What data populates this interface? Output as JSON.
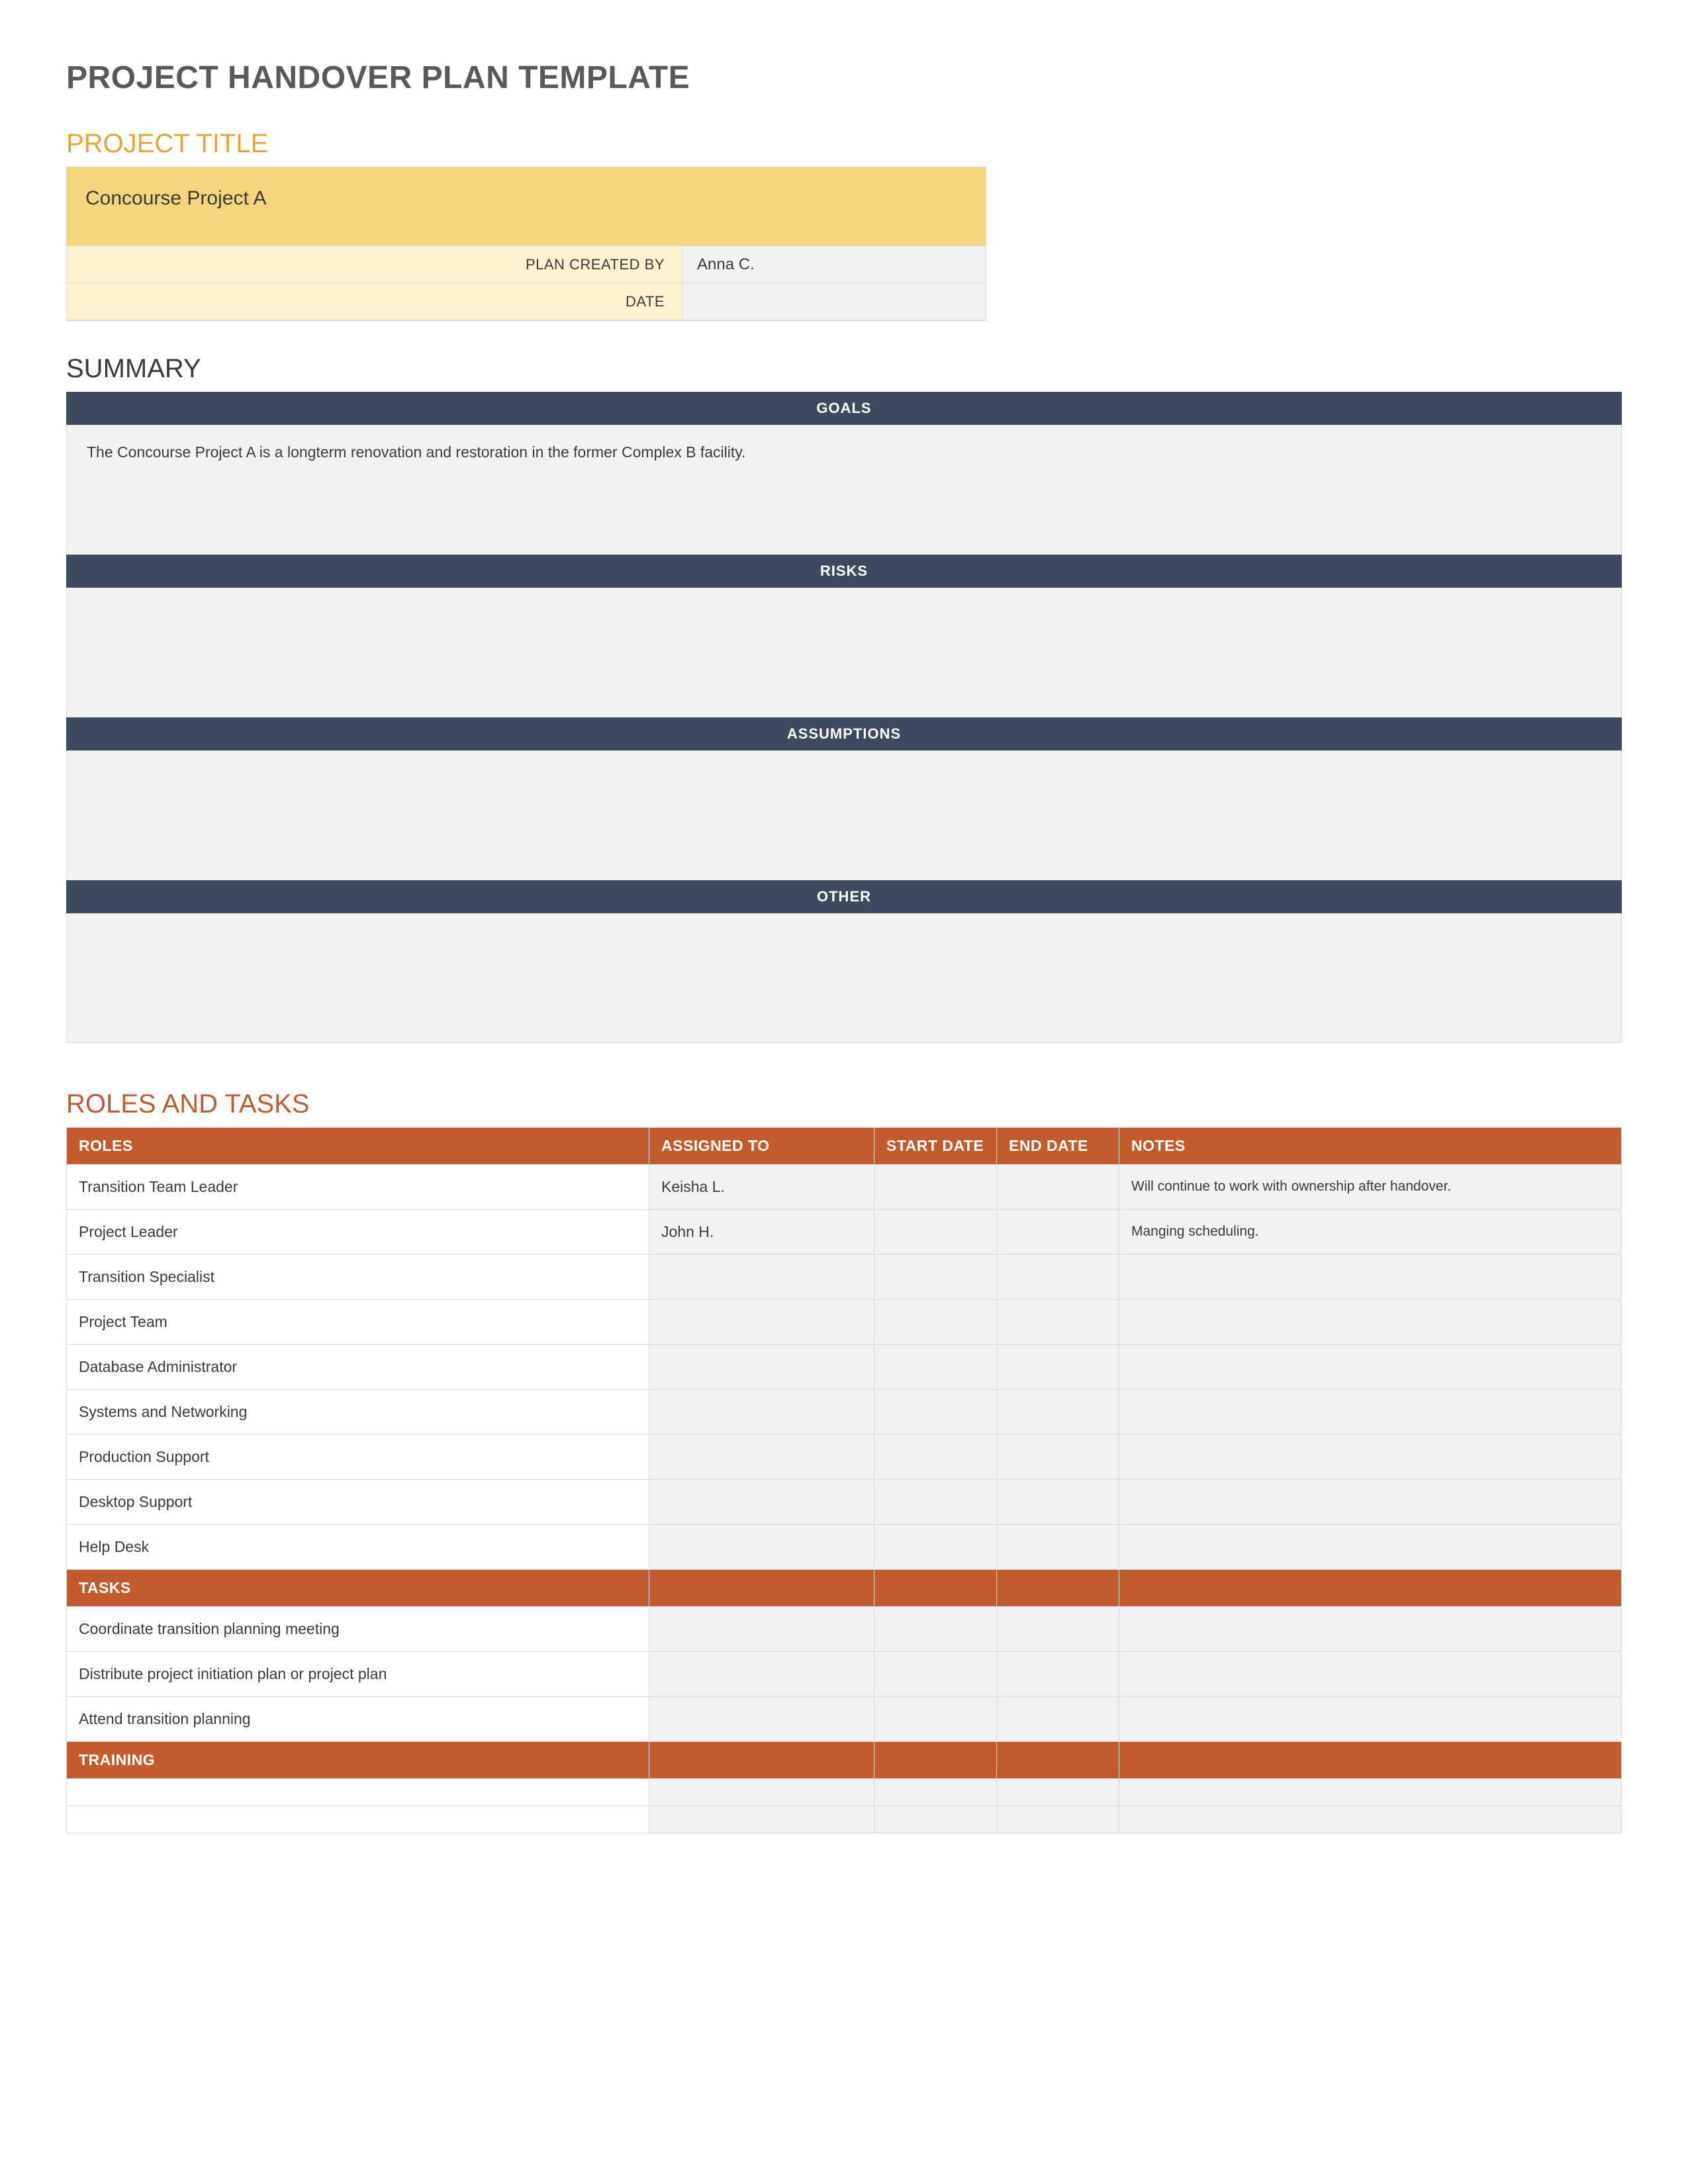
{
  "doc_title": "PROJECT HANDOVER PLAN TEMPLATE",
  "project_title": {
    "heading": "PROJECT TITLE",
    "name": "Concourse Project A",
    "plan_created_by_label": "PLAN CREATED BY",
    "plan_created_by_value": "Anna C.",
    "date_label": "DATE",
    "date_value": ""
  },
  "summary": {
    "heading": "SUMMARY",
    "sections": [
      {
        "title": "GOALS",
        "body": "The Concourse Project A is a longterm renovation and restoration in the former Complex B facility."
      },
      {
        "title": "RISKS",
        "body": ""
      },
      {
        "title": "ASSUMPTIONS",
        "body": ""
      },
      {
        "title": "OTHER",
        "body": ""
      }
    ]
  },
  "roles_tasks": {
    "heading": "ROLES AND TASKS",
    "columns": {
      "roles": "ROLES",
      "assigned_to": "ASSIGNED TO",
      "start_date": "START DATE",
      "end_date": "END DATE",
      "notes": "NOTES"
    },
    "roles_rows": [
      {
        "role": "Transition Team Leader",
        "assigned": "Keisha L.",
        "start": "",
        "end": "",
        "notes": "Will continue to work with ownership after handover."
      },
      {
        "role": "Project Leader",
        "assigned": "John H.",
        "start": "",
        "end": "",
        "notes": "Manging scheduling."
      },
      {
        "role": "Transition Specialist",
        "assigned": "",
        "start": "",
        "end": "",
        "notes": ""
      },
      {
        "role": "Project Team",
        "assigned": "",
        "start": "",
        "end": "",
        "notes": ""
      },
      {
        "role": "Database Administrator",
        "assigned": "",
        "start": "",
        "end": "",
        "notes": ""
      },
      {
        "role": "Systems and Networking",
        "assigned": "",
        "start": "",
        "end": "",
        "notes": ""
      },
      {
        "role": "Production Support",
        "assigned": "",
        "start": "",
        "end": "",
        "notes": ""
      },
      {
        "role": "Desktop Support",
        "assigned": "",
        "start": "",
        "end": "",
        "notes": ""
      },
      {
        "role": "Help Desk",
        "assigned": "",
        "start": "",
        "end": "",
        "notes": ""
      }
    ],
    "tasks_header": "TASKS",
    "tasks_rows": [
      {
        "role": "Coordinate transition planning meeting",
        "assigned": "",
        "start": "",
        "end": "",
        "notes": ""
      },
      {
        "role": "Distribute project initiation plan or project plan",
        "assigned": "",
        "start": "",
        "end": "",
        "notes": ""
      },
      {
        "role": "Attend transition planning",
        "assigned": "",
        "start": "",
        "end": "",
        "notes": ""
      }
    ],
    "training_header": "TRAINING",
    "training_rows": [
      {
        "role": "",
        "assigned": "",
        "start": "",
        "end": "",
        "notes": ""
      },
      {
        "role": "",
        "assigned": "",
        "start": "",
        "end": "",
        "notes": ""
      }
    ]
  }
}
